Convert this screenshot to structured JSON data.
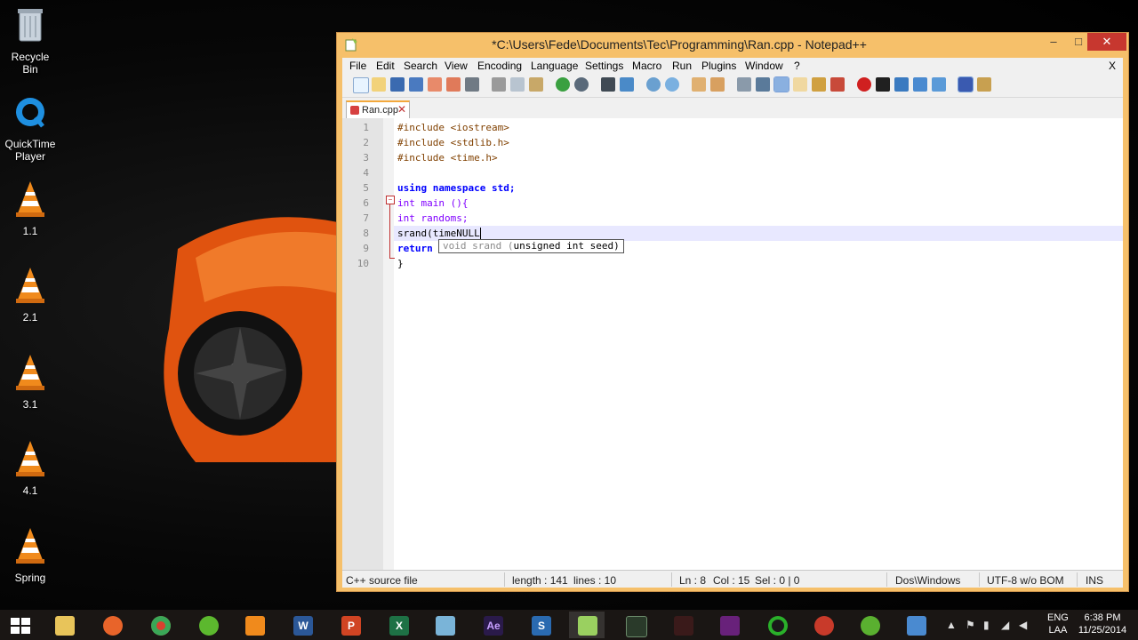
{
  "desktop": {
    "icons": [
      {
        "label": "Recycle Bin",
        "icon": "recycle-bin-icon"
      },
      {
        "label": "QuickTime Player",
        "icon": "quicktime-icon"
      },
      {
        "label": "1.1",
        "icon": "vlc-cone-icon"
      },
      {
        "label": "2.1",
        "icon": "vlc-cone-icon"
      },
      {
        "label": "3.1",
        "icon": "vlc-cone-icon"
      },
      {
        "label": "4.1",
        "icon": "vlc-cone-icon"
      },
      {
        "label": "Spring",
        "icon": "vlc-cone-icon"
      }
    ]
  },
  "window": {
    "title": "*C:\\Users\\Fede\\Documents\\Tec\\Programming\\Ran.cpp - Notepad++",
    "min_label": "–",
    "max_label": "□",
    "close_label": "✕",
    "menu": [
      "File",
      "Edit",
      "Search",
      "View",
      "Encoding",
      "Language",
      "Settings",
      "Macro",
      "Run",
      "Plugins",
      "Window",
      "?"
    ],
    "menu_close": "X",
    "tab": {
      "label": "Ran.cpp",
      "close": "✕"
    }
  },
  "editor": {
    "line_numbers": [
      "1",
      "2",
      "3",
      "4",
      "5",
      "6",
      "7",
      "8",
      "9",
      "10"
    ],
    "lines": [
      "#include <iostream>",
      "#include <stdlib.h>",
      "#include <time.h>",
      "",
      "using namespace std;",
      "int main (){",
      "int randoms;",
      "srand(timeNULL",
      "return",
      "}"
    ],
    "calltip": {
      "prefix": "void srand (",
      "emph": "unsigned int seed)"
    }
  },
  "statusbar": {
    "filetype": "C++ source file",
    "length": "length : 141",
    "lines": "lines : 10",
    "ln": "Ln : 8",
    "col": "Col : 15",
    "sel": "Sel : 0 | 0",
    "eol": "Dos\\Windows",
    "encoding": "UTF-8 w/o BOM",
    "mode": "INS"
  },
  "taskbar": {
    "lang": "ENG",
    "lang2": "LAA",
    "time": "6:38 PM",
    "date": "11/25/2014"
  },
  "colors": {
    "window_frame": "#f6c06a",
    "keyword": "#0000ff",
    "current_line": "#e8e8ff"
  }
}
